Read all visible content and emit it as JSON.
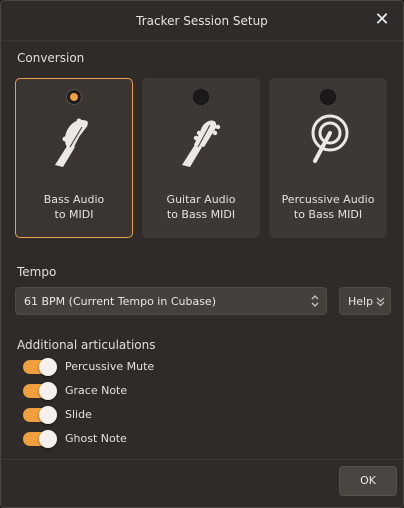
{
  "dialog": {
    "title": "Tracker Session Setup",
    "close_icon": "close-icon"
  },
  "conversion": {
    "label": "Conversion",
    "options": [
      {
        "line1": "Bass Audio",
        "line2": "to MIDI",
        "icon": "bass-guitar-headstock-icon",
        "selected": true
      },
      {
        "line1": "Guitar Audio",
        "line2": "to Bass MIDI",
        "icon": "guitar-headstock-icon",
        "selected": false
      },
      {
        "line1": "Percussive Audio",
        "line2": "to Bass MIDI",
        "icon": "drum-stick-icon",
        "selected": false
      }
    ]
  },
  "tempo": {
    "label": "Tempo",
    "selected_value": "61 BPM (Current Tempo in Cubase)",
    "help_label": "Help"
  },
  "articulations": {
    "label": "Additional articulations",
    "items": [
      {
        "label": "Percussive Mute",
        "enabled": true
      },
      {
        "label": "Grace Note",
        "enabled": true
      },
      {
        "label": "Slide",
        "enabled": true
      },
      {
        "label": "Ghost Note",
        "enabled": true
      }
    ]
  },
  "footer": {
    "ok_label": "OK"
  },
  "colors": {
    "accent": "#f0a040",
    "background": "#2f2b28",
    "card": "#3d3835"
  }
}
